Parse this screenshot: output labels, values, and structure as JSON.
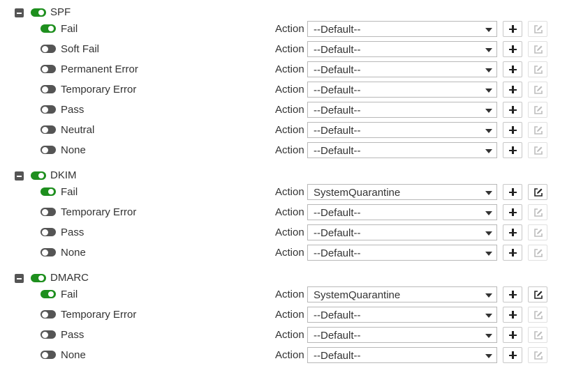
{
  "action_label": "Action",
  "colors": {
    "toggle_on": "#1e8f1e",
    "toggle_off": "#555555"
  },
  "groups": [
    {
      "name": "SPF",
      "enabled": true,
      "items": [
        {
          "label": "Fail",
          "enabled": true,
          "action": "--Default--",
          "edit_enabled": false
        },
        {
          "label": "Soft Fail",
          "enabled": false,
          "action": "--Default--",
          "edit_enabled": false
        },
        {
          "label": "Permanent Error",
          "enabled": false,
          "action": "--Default--",
          "edit_enabled": false
        },
        {
          "label": "Temporary Error",
          "enabled": false,
          "action": "--Default--",
          "edit_enabled": false
        },
        {
          "label": "Pass",
          "enabled": false,
          "action": "--Default--",
          "edit_enabled": false
        },
        {
          "label": "Neutral",
          "enabled": false,
          "action": "--Default--",
          "edit_enabled": false
        },
        {
          "label": "None",
          "enabled": false,
          "action": "--Default--",
          "edit_enabled": false
        }
      ]
    },
    {
      "name": "DKIM",
      "enabled": true,
      "items": [
        {
          "label": "Fail",
          "enabled": true,
          "action": "SystemQuarantine",
          "edit_enabled": true
        },
        {
          "label": "Temporary Error",
          "enabled": false,
          "action": "--Default--",
          "edit_enabled": false
        },
        {
          "label": "Pass",
          "enabled": false,
          "action": "--Default--",
          "edit_enabled": false
        },
        {
          "label": "None",
          "enabled": false,
          "action": "--Default--",
          "edit_enabled": false
        }
      ]
    },
    {
      "name": "DMARC",
      "enabled": true,
      "items": [
        {
          "label": "Fail",
          "enabled": true,
          "action": "SystemQuarantine",
          "edit_enabled": true
        },
        {
          "label": "Temporary Error",
          "enabled": false,
          "action": "--Default--",
          "edit_enabled": false
        },
        {
          "label": "Pass",
          "enabled": false,
          "action": "--Default--",
          "edit_enabled": false
        },
        {
          "label": "None",
          "enabled": false,
          "action": "--Default--",
          "edit_enabled": false
        }
      ]
    }
  ]
}
